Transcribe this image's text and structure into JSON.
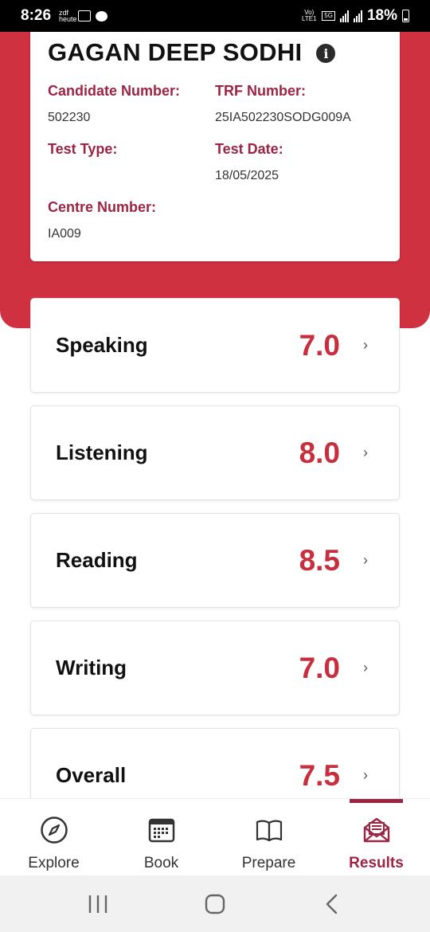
{
  "status_bar": {
    "time": "8:26",
    "notif_text": "zdf heute",
    "network_label": "Vo) LTE1",
    "network_5g": "5G",
    "battery": "18%"
  },
  "candidate": {
    "name": "GAGAN DEEP SODHI",
    "info_glyph": "i",
    "fields": {
      "candidate_number_label": "Candidate Number:",
      "candidate_number_value": "502230",
      "trf_number_label": "TRF Number:",
      "trf_number_value": "25IA502230SODG009A",
      "test_type_label": "Test Type:",
      "test_type_value": "",
      "test_date_label": "Test Date:",
      "test_date_value": "18/05/2025",
      "centre_number_label": "Centre Number:",
      "centre_number_value": "IA009"
    }
  },
  "scores": [
    {
      "label": "Speaking",
      "value": "7.0"
    },
    {
      "label": "Listening",
      "value": "8.0"
    },
    {
      "label": "Reading",
      "value": "8.5"
    },
    {
      "label": "Writing",
      "value": "7.0"
    },
    {
      "label": "Overall",
      "value": "7.5"
    }
  ],
  "chevron": "›",
  "nav": {
    "items": [
      {
        "label": "Explore",
        "icon": "compass-icon"
      },
      {
        "label": "Book",
        "icon": "calendar-icon"
      },
      {
        "label": "Prepare",
        "icon": "book-icon"
      },
      {
        "label": "Results",
        "icon": "envelope-icon"
      }
    ],
    "active": "Results"
  },
  "colors": {
    "brand_red": "#d03140",
    "score_red": "#c72f3f",
    "label_maroon": "#9b2543"
  }
}
